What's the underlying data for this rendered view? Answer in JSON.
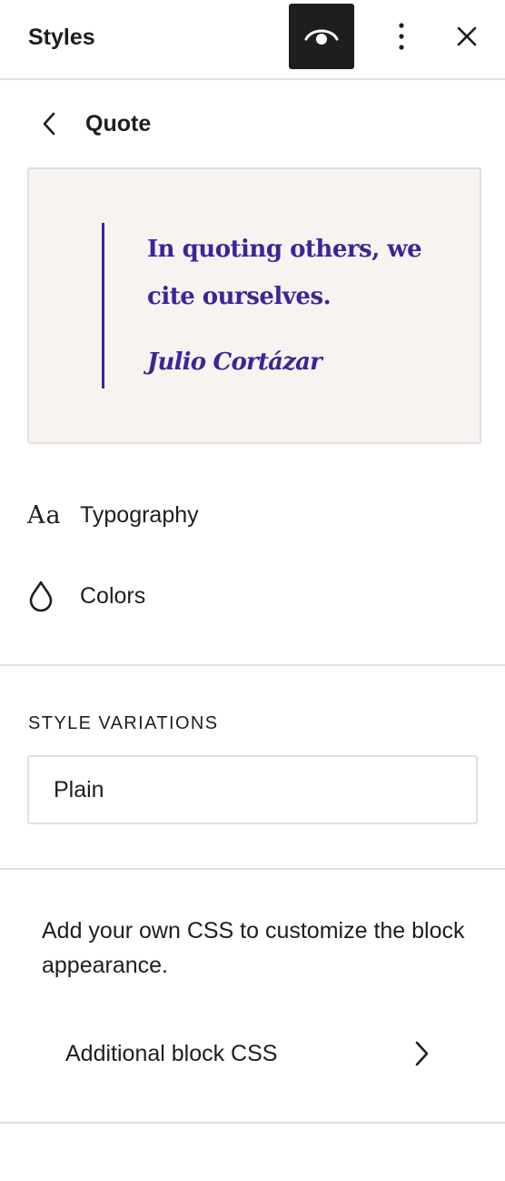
{
  "header": {
    "title": "Styles",
    "preview_icon": "eye-icon",
    "options_icon": "more-vertical-icon",
    "close_icon": "close-icon"
  },
  "nav": {
    "back_icon": "chevron-left-icon",
    "title": "Quote"
  },
  "preview": {
    "quote_text": "In quoting others, we cite ourselves.",
    "citation": "Julio Cortázar",
    "background": "#f7f3f1",
    "accent": "#3d2596"
  },
  "menu": [
    {
      "icon": "typography-icon",
      "icon_glyph": "Aa",
      "label": "Typography"
    },
    {
      "icon": "drop-icon",
      "label": "Colors"
    }
  ],
  "style_variations": {
    "heading": "STYLE VARIATIONS",
    "selected": "Plain"
  },
  "custom_css": {
    "description": "Add your own CSS to customize the block appearance.",
    "item_label": "Additional block CSS",
    "item_icon": "chevron-right-icon"
  }
}
